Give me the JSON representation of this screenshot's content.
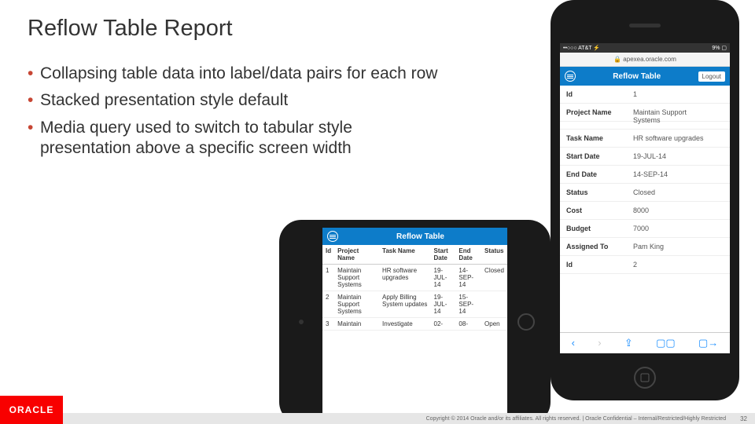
{
  "slide": {
    "title": "Reflow Table Report",
    "bullets": [
      "Collapsing table data into label/data pairs for each row",
      "Stacked presentation style default",
      "Media query used to switch to tabular style presentation above a specific screen width"
    ],
    "logo": "ORACLE",
    "copyright": "Copyright © 2014 Oracle and/or its affiliates. All rights reserved.  |  Oracle Confidential – Internal/Restricted/Highly Restricted",
    "page": "32"
  },
  "tablet": {
    "app_title": "Reflow Table",
    "headers": [
      "Id",
      "Project Name",
      "Task Name",
      "Start Date",
      "End Date",
      "Status"
    ],
    "rows": [
      [
        "1",
        "Maintain Support Systems",
        "HR software upgrades",
        "19-JUL-14",
        "14-SEP-14",
        "Closed"
      ],
      [
        "2",
        "Maintain Support Systems",
        "Apply Billing System updates",
        "19-JUL-14",
        "15-SEP-14",
        ""
      ],
      [
        "3",
        "Maintain",
        "Investigate",
        "02-",
        "08-",
        "Open"
      ]
    ]
  },
  "phone": {
    "carrier": "••○○○ AT&T ⚡",
    "status_right": "9% ▢",
    "url": "🔒 apexea.oracle.com",
    "app_title": "Reflow Table",
    "logout": "Logout",
    "rows": [
      {
        "label": "Id",
        "value": "1"
      },
      {
        "label": "Project Name",
        "value": "Maintain Support"
      },
      {
        "label": "",
        "value": "Systems",
        "cont": true
      },
      {
        "label": "Task Name",
        "value": "HR software upgrades"
      },
      {
        "label": "Start Date",
        "value": "19-JUL-14"
      },
      {
        "label": "End Date",
        "value": "14-SEP-14"
      },
      {
        "label": "Status",
        "value": "Closed"
      },
      {
        "label": "Cost",
        "value": "8000"
      },
      {
        "label": "Budget",
        "value": "7000"
      },
      {
        "label": "Assigned To",
        "value": "Pam King"
      },
      {
        "label": "Id",
        "value": "2"
      }
    ],
    "safari_icons": [
      "‹",
      "›",
      "⇪",
      "▢▢",
      "▢→"
    ]
  }
}
